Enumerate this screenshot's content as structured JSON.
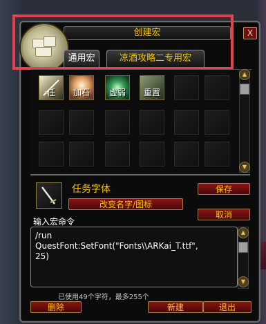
{
  "window": {
    "title": "创建宏",
    "close_label": "X"
  },
  "tabs": [
    {
      "label": "通用宏",
      "active": true
    },
    {
      "label": "凉酒攻略二专用宏",
      "active": false
    }
  ],
  "macro_slots": [
    {
      "label": "任",
      "icon": "sword-icon",
      "filled": true
    },
    {
      "label": "加石",
      "icon": "holy-light-icon",
      "filled": true
    },
    {
      "label": "虚弱",
      "icon": "green-swirl-icon",
      "filled": true
    },
    {
      "label": "重置",
      "icon": "scroll-icon",
      "filled": true
    }
  ],
  "selected_macro": {
    "name": "任务字体",
    "icon": "sword-icon"
  },
  "buttons": {
    "save": "保存",
    "cancel": "取消",
    "change_name_icon": "改变名字/图标",
    "delete": "删除",
    "new": "新建",
    "exit": "退出"
  },
  "editor": {
    "label": "输入宏命令",
    "text": "/run\nQuestFont:SetFont(\"Fonts\\\\ARKai_T.ttf\",\n25)"
  },
  "status": {
    "char_count": "已使用49个字符，最多255个"
  },
  "colors": {
    "gold_text": "#f5c400",
    "button_red": "#8a1414",
    "highlight_red": "#e5414f"
  }
}
